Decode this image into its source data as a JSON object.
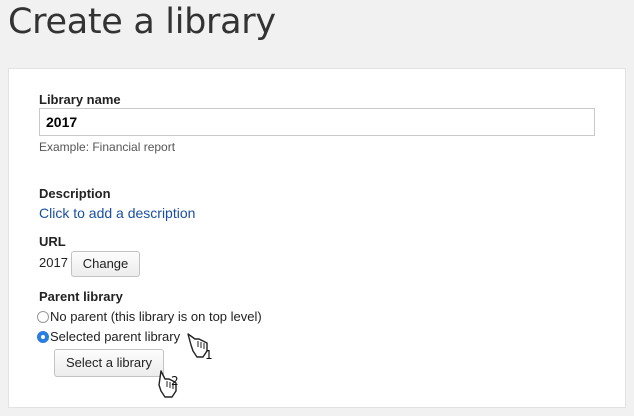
{
  "page": {
    "title": "Create a library"
  },
  "form": {
    "name_label": "Library name",
    "name_value": "2017",
    "name_hint": "Example: Financial report",
    "description_label": "Description",
    "description_link": "Click to add a description",
    "url_label": "URL",
    "url_value": "2017",
    "url_change_label": "Change",
    "parent_label": "Parent library",
    "parent_options": [
      {
        "label": "No parent (this library is on top level)",
        "selected": false
      },
      {
        "label": "Selected parent library",
        "selected": true
      }
    ],
    "select_library_label": "Select a library"
  },
  "annotations": [
    {
      "number": "1",
      "icon": "pointing-hand-icon"
    },
    {
      "number": "2",
      "icon": "pointing-hand-icon"
    }
  ],
  "colors": {
    "accent": "#2a7de1",
    "link": "#1a4fa0",
    "background": "#f1f1f1"
  }
}
